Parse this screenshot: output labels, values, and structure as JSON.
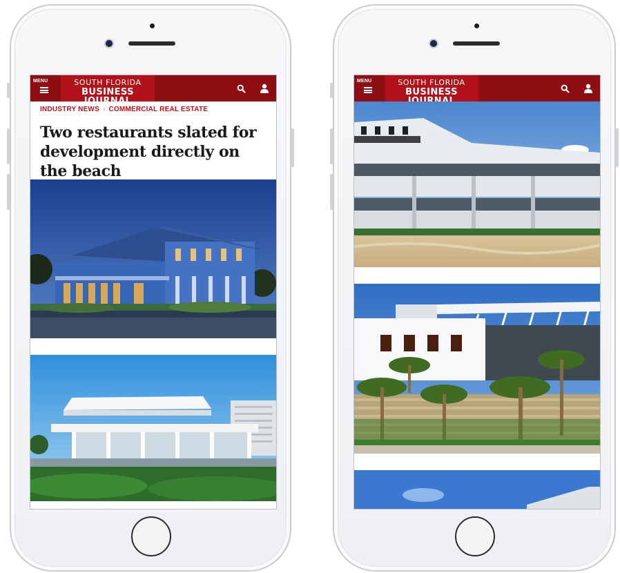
{
  "header": {
    "menu_label": "MENU",
    "logo_line1": "SOUTH FLORIDA",
    "logo_line2": "BUSINESS JOURNAL"
  },
  "article": {
    "breadcrumb": [
      "INDUSTRY NEWS",
      "COMMERCIAL REAL ESTATE"
    ],
    "breadcrumb_separator": "›",
    "headline": "Two restaurants slated for development directly on the beach"
  },
  "colors": {
    "header_bg": "#8d0f14",
    "logo_bg": "#b1121a",
    "breadcrumb": "#c0101b"
  },
  "icons": [
    "menu-icon",
    "search-icon",
    "user-icon",
    "camera-icon",
    "speaker-icon",
    "home-button-icon"
  ]
}
